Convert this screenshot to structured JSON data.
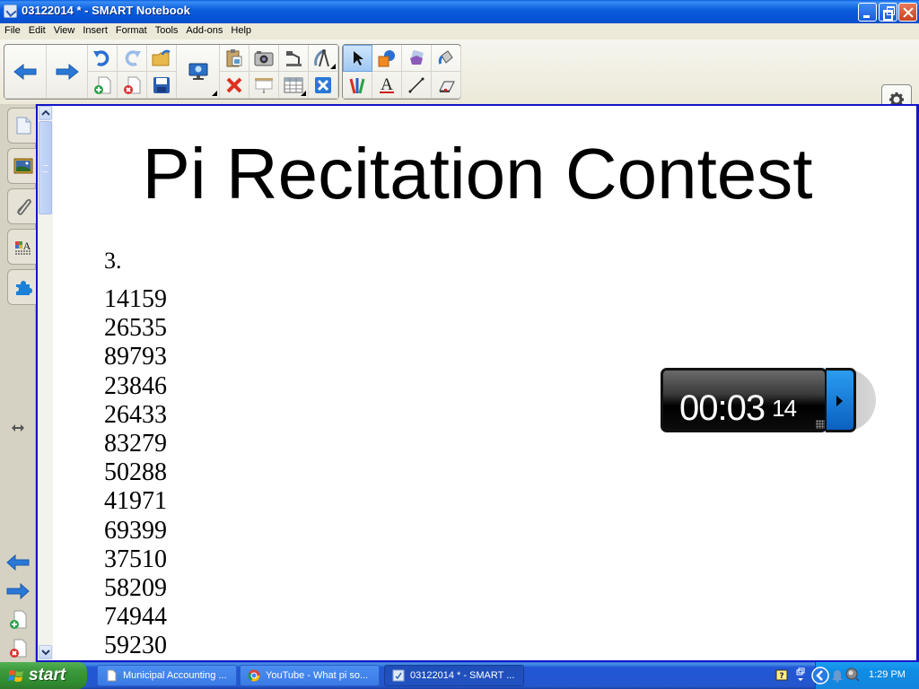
{
  "window": {
    "title": "03122014 * - SMART Notebook",
    "buttons": {
      "minimize": "minimize",
      "maximize": "restore",
      "close": "close"
    }
  },
  "menu": [
    "File",
    "Edit",
    "View",
    "Insert",
    "Format",
    "Tools",
    "Add-ons",
    "Help"
  ],
  "toolbar": {
    "groups": [
      {
        "name": "navigation",
        "items": [
          "back-arrow-icon",
          "forward-arrow-icon"
        ]
      },
      {
        "name": "file",
        "items": [
          "undo-icon",
          "redo-icon",
          "open-folder-icon",
          "add-page-icon",
          "delete-page-icon",
          "save-icon"
        ]
      },
      {
        "name": "display",
        "items": [
          "screen-shade-monitor-icon"
        ]
      },
      {
        "name": "insert",
        "items": [
          "paste-icon",
          "screen-capture-icon",
          "document-camera-icon",
          "measurement-tools-icon",
          "delete-icon",
          "screen-shade-icon",
          "table-icon",
          "full-screen-icon"
        ]
      },
      {
        "name": "drawing",
        "items": [
          "select-icon",
          "shapes-icon",
          "magic-pen-icon",
          "fill-icon",
          "pens-icon",
          "text-icon",
          "line-icon",
          "eraser-icon"
        ]
      }
    ],
    "selected_tool": "select",
    "right_panel": [
      "settings-gear-icon",
      "move-toolbar-icon"
    ]
  },
  "sidebar": {
    "tabs": [
      "page-sorter",
      "gallery",
      "attachments",
      "properties",
      "add-ons"
    ],
    "bottom_buttons": [
      "previous-page",
      "next-page",
      "add-page",
      "delete-page"
    ],
    "resize_handle": "resize-handle-icon"
  },
  "page": {
    "title": "Pi Recitation Contest",
    "intro": "3.",
    "digits": [
      "14159",
      "26535",
      "89793",
      "23846",
      "26433",
      "83279",
      "50288",
      "41971",
      "69399",
      "37510",
      "58209",
      "74944",
      "59230"
    ]
  },
  "timer": {
    "minutes": "00",
    "seconds": "03",
    "hundredths": "14",
    "separator": ":"
  },
  "taskbar": {
    "start_label": "start",
    "tasks": [
      {
        "label": "Municipal Accounting ...",
        "icon": "document-icon",
        "active": false
      },
      {
        "label": "YouTube - What pi so...",
        "icon": "chrome-icon",
        "active": false
      },
      {
        "label": "03122014 * - SMART ...",
        "icon": "smart-notebook-icon",
        "active": true
      }
    ],
    "tray": {
      "clock": "1:29 PM"
    }
  },
  "colors": {
    "canvas_border": "#1515c8",
    "titlebar": "#0552d6",
    "taskbar": "#2456cc",
    "start_button": "#3c9a3c",
    "timer_play": "#1a80e0"
  }
}
